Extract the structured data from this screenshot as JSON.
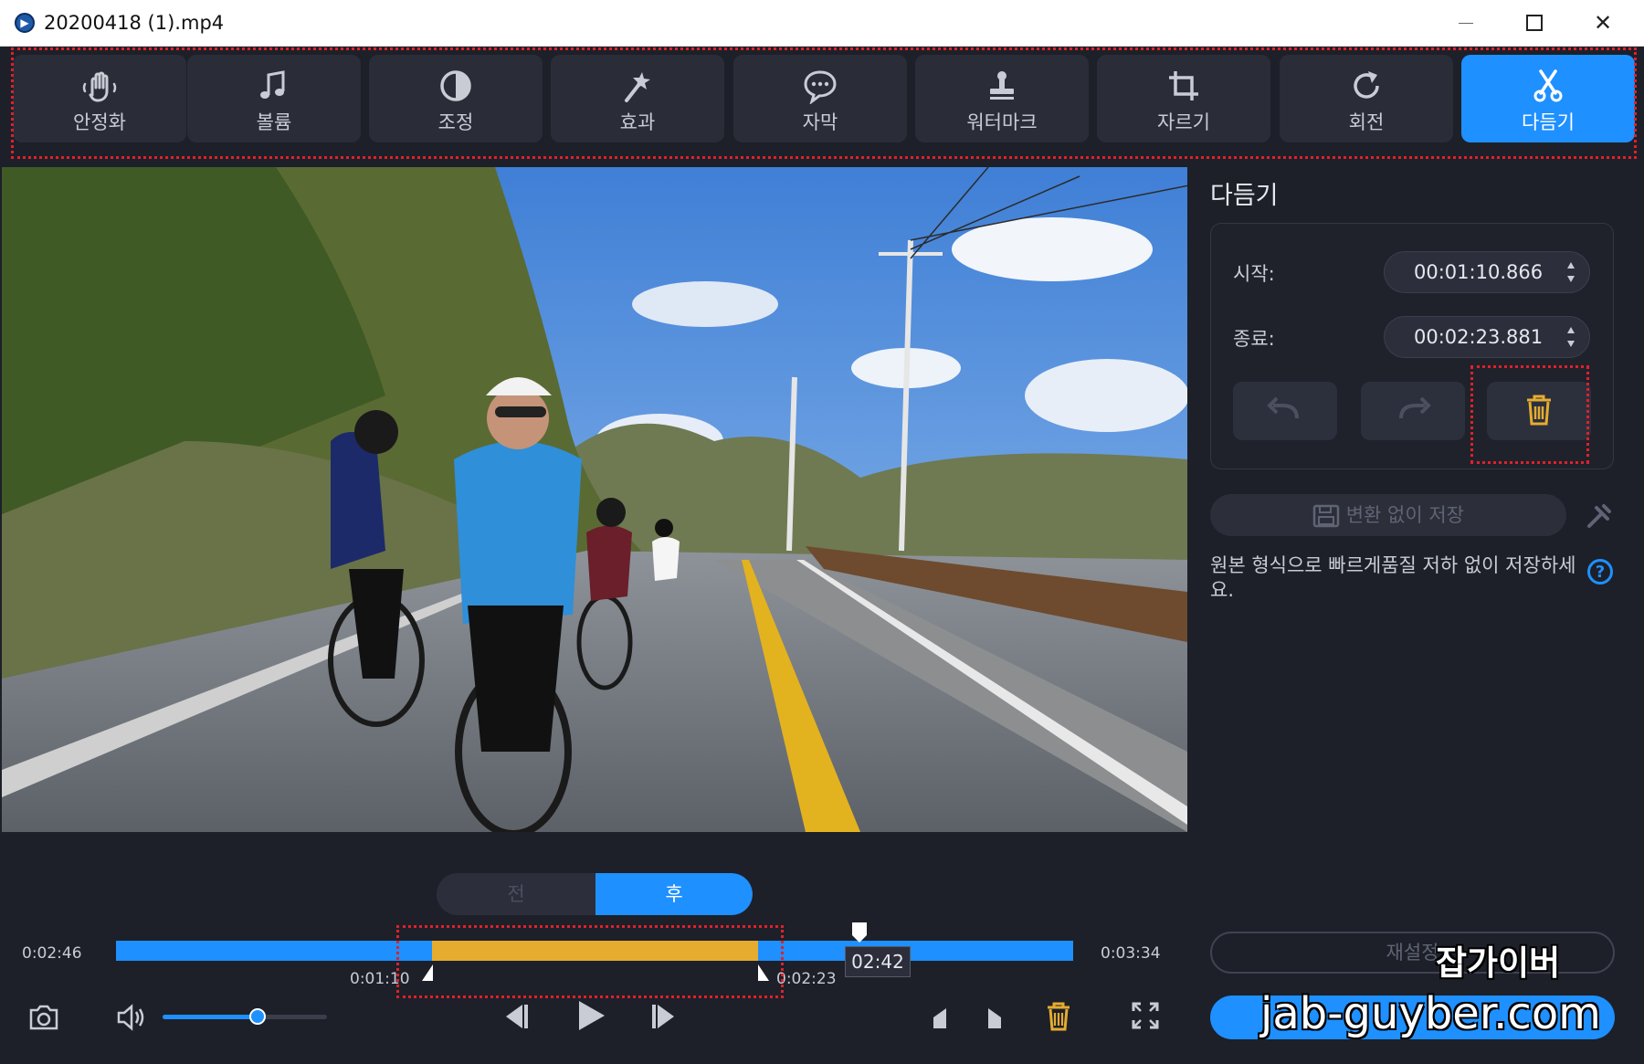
{
  "window": {
    "title": "20200418 (1).mp4",
    "minimize": "—",
    "maximize": "☐",
    "close": "✕"
  },
  "colors": {
    "accent": "#1e90ff",
    "trim_region": "#e6ac30",
    "highlight_dotted": "#e0202a",
    "background": "#1d2029"
  },
  "toolbar": {
    "items": [
      {
        "label": "안정화",
        "icon": "stabilize-hand-icon"
      },
      {
        "label": "볼륨",
        "icon": "music-note-icon"
      },
      {
        "label": "조정",
        "icon": "contrast-icon"
      },
      {
        "label": "효과",
        "icon": "magic-wand-icon"
      },
      {
        "label": "자막",
        "icon": "speech-bubble-icon"
      },
      {
        "label": "워터마크",
        "icon": "stamp-icon"
      },
      {
        "label": "자르기",
        "icon": "crop-icon"
      },
      {
        "label": "회전",
        "icon": "rotate-icon"
      },
      {
        "label": "다듬기",
        "icon": "scissors-icon",
        "active": true
      }
    ]
  },
  "trim_panel": {
    "title": "다듬기",
    "start_label": "시작:",
    "start_value": "00:01:10.866",
    "end_label": "종료:",
    "end_value": "00:02:23.881",
    "undo_icon": "undo-icon",
    "redo_icon": "redo-icon",
    "delete_icon": "trash-icon",
    "save_button": "변환 없이 저장",
    "hint": "원본 형식으로 빠르게품질 저하 없이 저장하세요.",
    "help": "?",
    "reset_button": "재설정"
  },
  "before_after": {
    "before": "전",
    "after": "후"
  },
  "timeline": {
    "current_left": "0:02:46",
    "duration": "0:03:34",
    "trim_start": "0:01:10",
    "trim_end": "0:02:23",
    "playhead": "02:42"
  },
  "controls": {
    "volume_level": 0.58
  },
  "watermark": {
    "name": "잡가이버",
    "url": "jab-guyber.com"
  }
}
